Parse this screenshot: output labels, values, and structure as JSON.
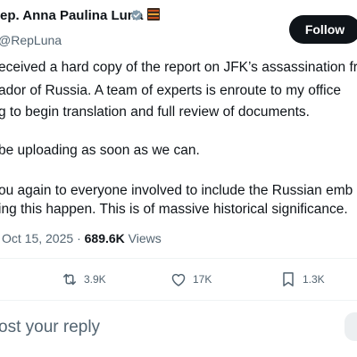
{
  "author": {
    "name": "ep. Anna Paulina Luna",
    "handle": "RepLuna"
  },
  "follow_label": "Follow",
  "tweet": {
    "lines": [
      "eceived a hard copy of the report on JFK’s assassination fr",
      "ador of Russia. A team of experts is enroute to my office",
      "g to begin translation and full review of documents.",
      "be uploading as soon as we can.",
      "ou again to everyone involved to include the Russian emb",
      "ing this happen. This is of massive historical significance."
    ]
  },
  "meta": {
    "date": "Oct 15, 2025",
    "separator": "·",
    "views_count": "689.6K",
    "views_label": "Views"
  },
  "actions": {
    "reposts": "3.9K",
    "likes": "17K",
    "bookmarks": "1.3K"
  },
  "reply": {
    "placeholder": "ost your reply"
  },
  "icons": {
    "verified": "verified-badge-icon",
    "flag": "flag-emoji-icon",
    "repost": "repost-icon",
    "like": "heart-icon",
    "bookmark": "bookmark-icon"
  },
  "colors": {
    "text": "#0f1419",
    "secondary": "#536471",
    "verified": "#829aab",
    "follow_bg": "#0f1419",
    "divider": "#eff3f4"
  }
}
